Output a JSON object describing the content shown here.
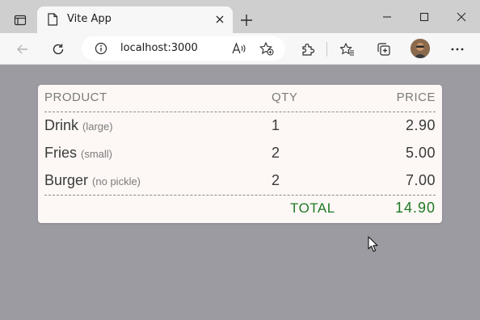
{
  "browser": {
    "tab_title": "Vite App",
    "url": "localhost:3000",
    "icons": {
      "tab_actions": "tab-actions-icon",
      "favicon": "page-icon",
      "tab_close": "close-icon",
      "new_tab": "plus-icon",
      "minimize": "minimize-icon",
      "maximize": "maximize-icon",
      "close_window": "close-icon",
      "back": "back-arrow-icon",
      "refresh": "refresh-icon",
      "site_info": "info-icon",
      "read_aloud": "read-aloud-icon",
      "add_favorite": "star-add-icon",
      "extensions": "puzzle-icon",
      "favorites": "favorites-icon",
      "collections": "collections-icon",
      "profile": "avatar",
      "more": "more-icon"
    }
  },
  "receipt": {
    "headers": {
      "product": "PRODUCT",
      "qty": "QTY",
      "price": "PRICE"
    },
    "rows": [
      {
        "name": "Drink",
        "note": "(large)",
        "qty": "1",
        "price": "2.90"
      },
      {
        "name": "Fries",
        "note": "(small)",
        "qty": "2",
        "price": "5.00"
      },
      {
        "name": "Burger",
        "note": "(no pickle)",
        "qty": "2",
        "price": "7.00"
      }
    ],
    "total_label": "TOTAL",
    "total_value": "14.90"
  },
  "colors": {
    "page_background": "#9c9ba2",
    "card_background": "#fdf8f5",
    "total_green": "#1f7a26",
    "header_gray": "#7b7b7b"
  }
}
